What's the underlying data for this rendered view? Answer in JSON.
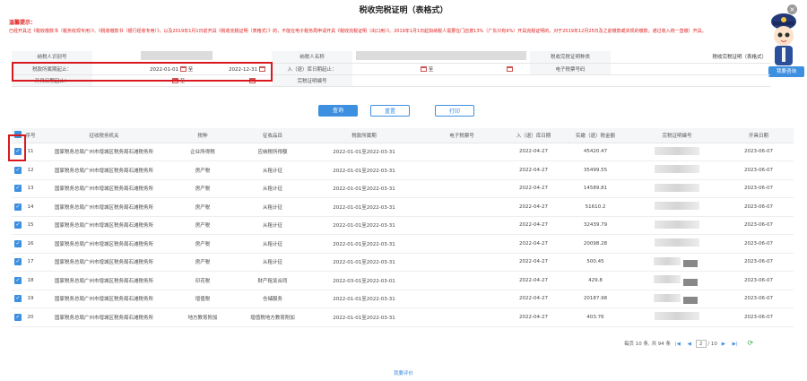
{
  "title": "税收完税证明（表格式）",
  "notice": {
    "heading": "温馨提示：",
    "body": "已经开具过《税收缴款书（税务收现专用）》、《税收缴款书（银行经收专用）》，以及2019年1月1日前开具《税收完税证明（表格式）》的，不能在电子税务局申请开具《税收完税证明（出口用）》。2019年1月1日起如纳税人需要在门店按13%（广东只有9%）开具完税证明的，对于2019年12月25日及之前缴款或实现的缴款，通过收入统一直缴）开具。"
  },
  "form": {
    "taxpayer_id_label": "纳税人识别号",
    "taxpayer_name_label": "纳税人名称",
    "cert_type_label": "税收完税证明种类",
    "cert_type_value": "税收完税证明（表格式）",
    "period_label": "税款所属期起止：",
    "period_start": "2022-01-01",
    "period_to": "至",
    "period_end": "2022-12-31",
    "entry_date_label": "入（退）库日期起止：",
    "entry_to": "至",
    "e_ticket_label": "电子税票号码",
    "issue_date_label": "开具日期起止：",
    "issue_to": "至",
    "cert_no_label": "完税证明编号"
  },
  "consult_label": "我要咨询",
  "buttons": {
    "query": "查询",
    "reset": "重置",
    "print": "打印"
  },
  "table": {
    "headers": [
      "序号",
      "征收税务机关",
      "税种",
      "征收品目",
      "税款所属期",
      "电子税票号",
      "入（退）库日期",
      "实缴（退）税金额",
      "完税证明编号",
      "开具日期"
    ],
    "rows": [
      {
        "no": "11",
        "org": "国家税务总局广州市增城区税务局石滩税务所",
        "tax": "企业所得税",
        "item": "应纳税所得额",
        "period": "2022-01-01至2022-03-31",
        "date": "2022-04-27",
        "amount": "45420.47",
        "issue": "2023-06-07"
      },
      {
        "no": "12",
        "org": "国家税务总局广州市增城区税务局石滩税务所",
        "tax": "房产税",
        "item": "从租计征",
        "period": "2022-01-01至2022-03-31",
        "date": "2022-04-27",
        "amount": "35499.55",
        "issue": "2023-06-07"
      },
      {
        "no": "13",
        "org": "国家税务总局广州市增城区税务局石滩税务所",
        "tax": "房产税",
        "item": "从租计征",
        "period": "2022-01-01至2022-03-31",
        "date": "2022-04-27",
        "amount": "14589.81",
        "issue": "2023-06-07"
      },
      {
        "no": "14",
        "org": "国家税务总局广州市增城区税务局石滩税务所",
        "tax": "房产税",
        "item": "从租计征",
        "period": "2022-01-01至2022-03-31",
        "date": "2022-04-27",
        "amount": "51610.2",
        "issue": "2023-06-07"
      },
      {
        "no": "15",
        "org": "国家税务总局广州市增城区税务局石滩税务所",
        "tax": "房产税",
        "item": "从租计征",
        "period": "2022-01-01至2022-03-31",
        "date": "2022-04-27",
        "amount": "32439.79",
        "issue": "2023-06-07"
      },
      {
        "no": "16",
        "org": "国家税务总局广州市增城区税务局石滩税务所",
        "tax": "房产税",
        "item": "从租计征",
        "period": "2022-01-01至2022-03-31",
        "date": "2022-04-27",
        "amount": "20098.28",
        "issue": "2023-06-07"
      },
      {
        "no": "17",
        "org": "国家税务总局广州市增城区税务局石滩税务所",
        "tax": "房产税",
        "item": "从租计征",
        "period": "2022-01-01至2022-03-31",
        "date": "2022-04-27",
        "amount": "500.45",
        "issue": "2023-06-07"
      },
      {
        "no": "18",
        "org": "国家税务总局广州市增城区税务局石滩税务所",
        "tax": "印花税",
        "item": "财产租赁合同",
        "period": "2022-03-01至2022-03-01",
        "date": "2022-04-27",
        "amount": "429.8",
        "issue": "2023-06-07"
      },
      {
        "no": "19",
        "org": "国家税务总局广州市增城区税务局石滩税务所",
        "tax": "增值税",
        "item": "仓储服务",
        "period": "2022-01-01至2022-03-31",
        "date": "2022-04-27",
        "amount": "20187.98",
        "issue": "2023-06-07"
      },
      {
        "no": "20",
        "org": "国家税务总局广州市增城区税务局石滩税务所",
        "tax": "地方教育附加",
        "item": "增值税地方教育附加",
        "period": "2022-01-01至2022-03-31",
        "date": "2022-04-27",
        "amount": "403.76",
        "issue": "2023-06-07"
      }
    ]
  },
  "pager": {
    "summary": "每页 10 条, 共 94 条",
    "current": "2",
    "total": "/ 10"
  },
  "footer": "我要评价",
  "colors": {
    "primary": "#3d8fe0",
    "highlight": "#d9191f",
    "warning_text": "#e02020"
  }
}
